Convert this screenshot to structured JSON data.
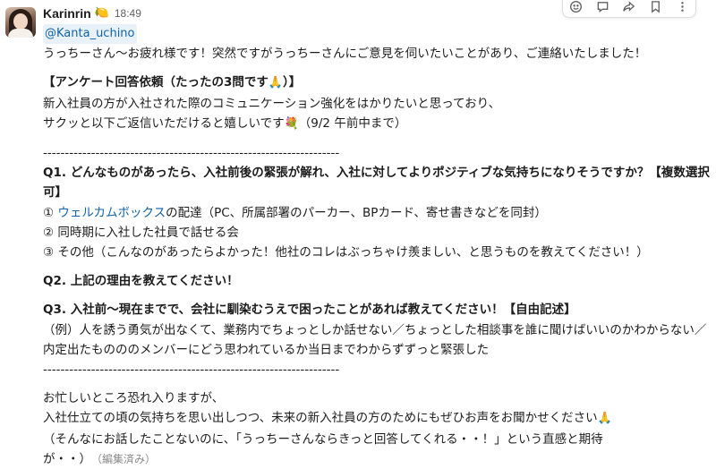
{
  "message": {
    "author": "Karinrin",
    "status_emoji": "🍋",
    "timestamp": "18:49",
    "mention": "@Kanta_uchino",
    "greeting": "うっちーさん～お疲れ様です！突然ですがうっちーさんにご意見を伺いたいことがあり、ご連絡いたしました！",
    "request_title": "【アンケート回答依頼（たったの3問です",
    "request_title_emoji": "🙏",
    "request_title_close": "）】",
    "intro_line1": "新入社員の方が入社された際のコミュニケーション強化をはかりたいと思っており、",
    "intro_line2": "サクッと以下ご返信いただけると嬉しいです",
    "intro_emoji": "💐",
    "intro_deadline": "（9/2 午前中まで）",
    "divider": "--------------------------------------------------------------------",
    "q1_line1": "Q1. どんなものがあったら、入社前後の緊張が解れ、入社に対してよりポジティブな気持ちになりそうですか？【複数選択",
    "q1_line2": "可】",
    "q1_opt1_prefix": "① ",
    "q1_opt1_link": "ウェルカムボックス",
    "q1_opt1_rest": "の配達（PC、所属部署のパーカー、BPカード、寄せ書きなどを同封）",
    "q1_opt2": "② 同時期に入社した社員で話せる会",
    "q1_opt3": "③ その他（こんなのがあったらよかった！他社のコレはぶっちゃけ羨ましい、と思うものを教えてください！）",
    "q2": "Q2. 上記の理由を教えてください！",
    "q3": "Q3. 入社前～現在までで、会社に馴染むうえで困ったことがあれば教えてください！【自由記述】",
    "q3_example_line1": "（例）人を誘う勇気が出なくて、業務内でちょっとしか話せない／ちょっとした相談事を誰に聞けばいいのかわからない／",
    "q3_example_line2": "内定出たものののメンバーにどう思われているか当日までわからずずっと緊張した",
    "closing_line1": "お忙しいところ恐れ入りますが、",
    "closing_line2": "入社仕立ての頃の気持ちを思い出しつつ、未来の新入社員の方のためにもぜひお声をお聞かせください",
    "closing_emoji": "🙏",
    "closing_line3": "（そんなにお話したことないのに、「うっちーさんならきっと回答してくれる・・！」という直感と期待",
    "closing_line4": "が・・）",
    "edited_label": "（編集済み）"
  },
  "toolbar": {
    "icons": [
      "add-reaction-icon",
      "reply-in-thread-icon",
      "share-message-icon",
      "bookmark-icon",
      "more-actions-icon"
    ]
  }
}
